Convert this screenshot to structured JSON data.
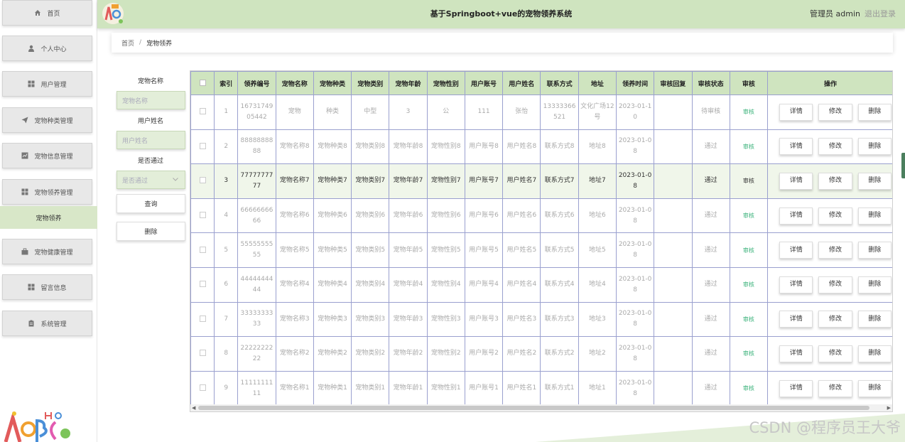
{
  "app": {
    "title": "基于Springboot+vue的宠物领养系统",
    "user_label": "管理员 admin",
    "logout_label": "退出登录"
  },
  "sidebar": {
    "items": [
      {
        "label": "首页",
        "icon": "home-icon"
      },
      {
        "label": "个人中心",
        "icon": "user-icon"
      },
      {
        "label": "用户管理",
        "icon": "grid-icon"
      },
      {
        "label": "宠物种类管理",
        "icon": "send-icon"
      },
      {
        "label": "宠物信息管理",
        "icon": "chart-icon"
      },
      {
        "label": "宠物领养管理",
        "icon": "grid-icon"
      }
    ],
    "sub_item": "宠物领养",
    "items2": [
      {
        "label": "宠物健康管理",
        "icon": "briefcase-icon"
      },
      {
        "label": "留言信息",
        "icon": "grid-icon"
      },
      {
        "label": "系统管理",
        "icon": "clipboard-icon"
      }
    ]
  },
  "breadcrumb": {
    "home": "首页",
    "separator": "/",
    "current": "宠物领养"
  },
  "search": {
    "pet_name_label": "宠物名称",
    "pet_name_placeholder": "宠物名称",
    "user_name_label": "用户姓名",
    "user_name_placeholder": "用户姓名",
    "passed_label": "是否通过",
    "passed_placeholder": "是否通过",
    "query_button": "查询",
    "delete_button": "删除"
  },
  "table": {
    "headers": [
      "索引",
      "领养编号",
      "宠物名称",
      "宠物种类",
      "宠物类别",
      "宠物年龄",
      "宠物性别",
      "用户账号",
      "用户姓名",
      "联系方式",
      "地址",
      "领养时间",
      "审核回复",
      "审核状态",
      "审核",
      "操作"
    ],
    "audit_link": "审核",
    "actions": {
      "detail": "详情",
      "edit": "修改",
      "delete": "删除"
    },
    "rows": [
      {
        "index": "1",
        "no": "1673174905442",
        "name": "宠物",
        "kind": "种类",
        "category": "中型",
        "age": "3",
        "gender": "公",
        "account": "111",
        "username": "张怡",
        "phone": "13333366521",
        "address": "文化广场12号",
        "time": "2023-01-10",
        "reply": "",
        "status": "待审核"
      },
      {
        "index": "2",
        "no": "8888888888",
        "name": "宠物名称8",
        "kind": "宠物种类8",
        "category": "宠物类别8",
        "age": "宠物年龄8",
        "gender": "宠物性别8",
        "account": "用户账号8",
        "username": "用户姓名8",
        "phone": "联系方式8",
        "address": "地址8",
        "time": "2023-01-08",
        "reply": "",
        "status": "通过"
      },
      {
        "index": "3",
        "no": "7777777777",
        "name": "宠物名称7",
        "kind": "宠物种类7",
        "category": "宠物类别7",
        "age": "宠物年龄7",
        "gender": "宠物性别7",
        "account": "用户账号7",
        "username": "用户姓名7",
        "phone": "联系方式7",
        "address": "地址7",
        "time": "2023-01-08",
        "reply": "",
        "status": "通过"
      },
      {
        "index": "4",
        "no": "6666666666",
        "name": "宠物名称6",
        "kind": "宠物种类6",
        "category": "宠物类别6",
        "age": "宠物年龄6",
        "gender": "宠物性别6",
        "account": "用户账号6",
        "username": "用户姓名6",
        "phone": "联系方式6",
        "address": "地址6",
        "time": "2023-01-08",
        "reply": "",
        "status": "通过"
      },
      {
        "index": "5",
        "no": "5555555555",
        "name": "宠物名称5",
        "kind": "宠物种类5",
        "category": "宠物类别5",
        "age": "宠物年龄5",
        "gender": "宠物性别5",
        "account": "用户账号5",
        "username": "用户姓名5",
        "phone": "联系方式5",
        "address": "地址5",
        "time": "2023-01-08",
        "reply": "",
        "status": "通过"
      },
      {
        "index": "6",
        "no": "4444444444",
        "name": "宠物名称4",
        "kind": "宠物种类4",
        "category": "宠物类别4",
        "age": "宠物年龄4",
        "gender": "宠物性别4",
        "account": "用户账号4",
        "username": "用户姓名4",
        "phone": "联系方式4",
        "address": "地址4",
        "time": "2023-01-08",
        "reply": "",
        "status": "通过"
      },
      {
        "index": "7",
        "no": "3333333333",
        "name": "宠物名称3",
        "kind": "宠物种类3",
        "category": "宠物类别3",
        "age": "宠物年龄3",
        "gender": "宠物性别3",
        "account": "用户账号3",
        "username": "用户姓名3",
        "phone": "联系方式3",
        "address": "地址3",
        "time": "2023-01-08",
        "reply": "",
        "status": "通过"
      },
      {
        "index": "8",
        "no": "2222222222",
        "name": "宠物名称2",
        "kind": "宠物种类2",
        "category": "宠物类别2",
        "age": "宠物年龄2",
        "gender": "宠物性别2",
        "account": "用户账号2",
        "username": "用户姓名2",
        "phone": "联系方式2",
        "address": "地址2",
        "time": "2023-01-08",
        "reply": "",
        "status": "通过"
      },
      {
        "index": "9",
        "no": "1111111111",
        "name": "宠物名称1",
        "kind": "宠物种类1",
        "category": "宠物类别1",
        "age": "宠物年龄1",
        "gender": "宠物性别1",
        "account": "用户账号1",
        "username": "用户姓名1",
        "phone": "联系方式1",
        "address": "地址1",
        "time": "2023-01-08",
        "reply": "",
        "status": "通过"
      }
    ]
  },
  "watermark": "CSDN @程序员王大爷",
  "colors": {
    "accent_green": "#cfe4bf",
    "grid_border": "#9aa0cf",
    "audit_link": "#3ab27a"
  }
}
